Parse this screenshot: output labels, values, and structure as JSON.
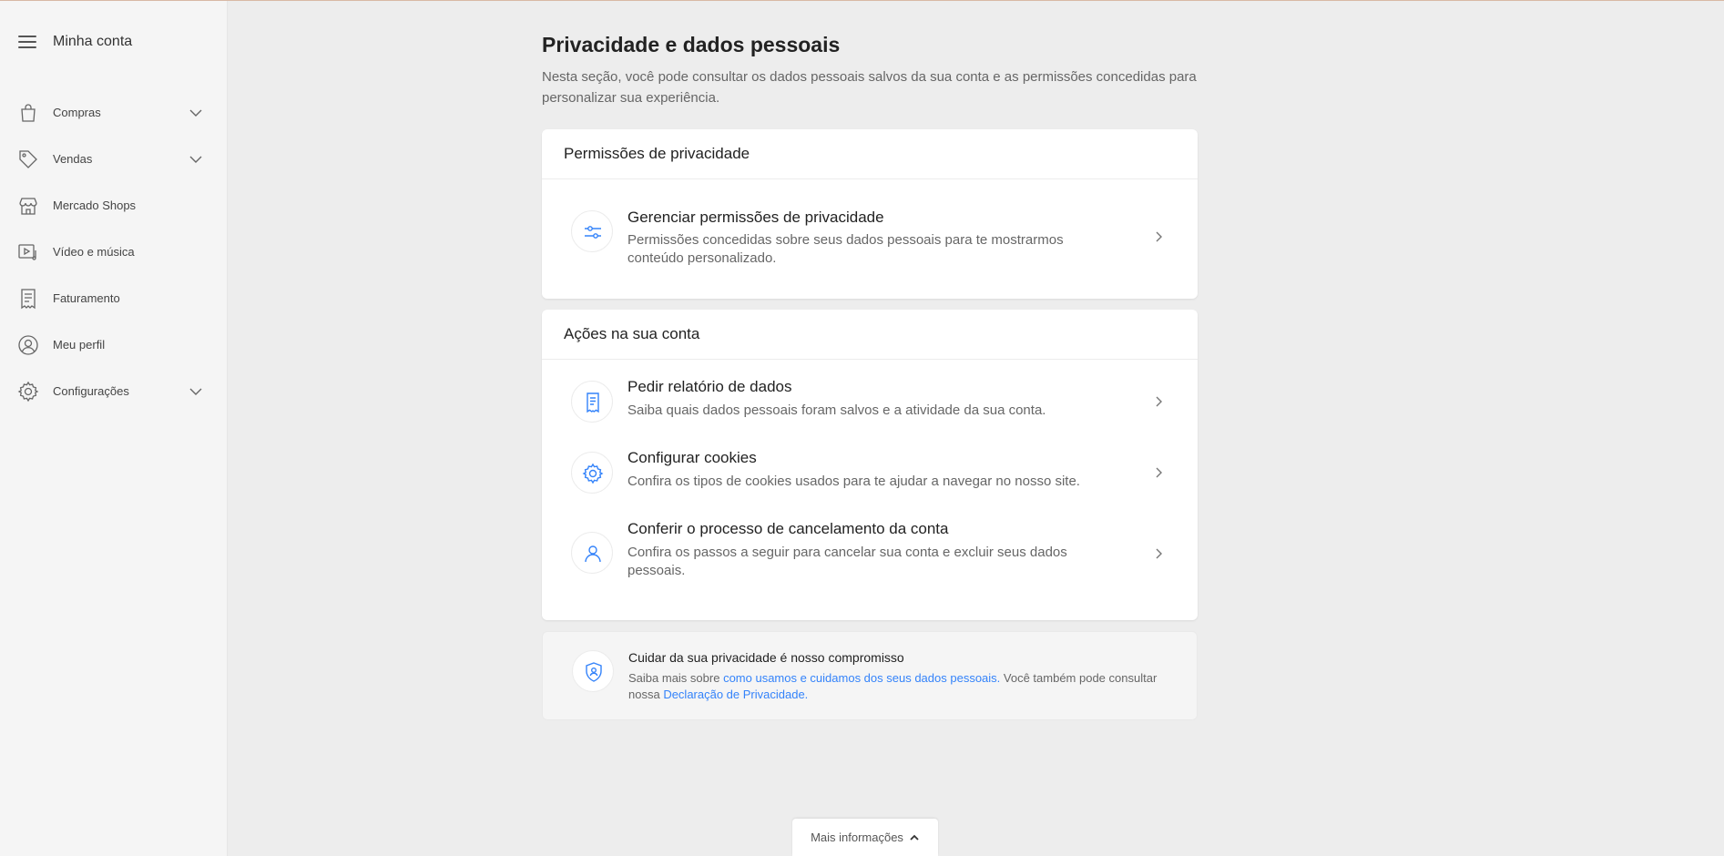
{
  "colors": {
    "accent": "#3483fa",
    "background": "#ededed",
    "sidebar": "#f5f5f5",
    "card": "#ffffff"
  },
  "sidebar": {
    "title": "Minha conta",
    "items": [
      {
        "label": "Compras",
        "icon": "bag-icon",
        "expandable": true
      },
      {
        "label": "Vendas",
        "icon": "tag-icon",
        "expandable": true
      },
      {
        "label": "Mercado Shops",
        "icon": "store-icon",
        "expandable": false
      },
      {
        "label": "Vídeo e música",
        "icon": "video-music-icon",
        "expandable": false
      },
      {
        "label": "Faturamento",
        "icon": "receipt-icon",
        "expandable": false
      },
      {
        "label": "Meu perfil",
        "icon": "profile-icon",
        "expandable": false
      },
      {
        "label": "Configurações",
        "icon": "gear-icon",
        "expandable": true
      }
    ]
  },
  "main": {
    "title": "Privacidade e dados pessoais",
    "description": "Nesta seção, você pode consultar os dados pessoais salvos da sua conta e as permissões concedidas para personalizar sua experiência.",
    "privacy_card": {
      "heading": "Permissões de privacidade",
      "rows": [
        {
          "title": "Gerenciar permissões de privacidade",
          "description": "Permissões concedidas sobre seus dados pessoais para te mostrarmos conteúdo personalizado.",
          "icon": "sliders-icon"
        }
      ]
    },
    "actions_card": {
      "heading": "Ações na sua conta",
      "rows": [
        {
          "title": "Pedir relatório de dados",
          "description": "Saiba quais dados pessoais foram salvos e a atividade da sua conta.",
          "icon": "report-icon"
        },
        {
          "title": "Configurar cookies",
          "description": "Confira os tipos de cookies usados para te ajudar a navegar no nosso site.",
          "icon": "gear-icon"
        },
        {
          "title": "Conferir o processo de cancelamento da conta",
          "description": "Confira os passos a seguir para cancelar sua conta e excluir seus dados pessoais.",
          "icon": "user-icon"
        }
      ]
    },
    "notice": {
      "title": "Cuidar da sua privacidade é nosso compromisso",
      "text_before": "Saiba mais sobre ",
      "link1": "como usamos e cuidamos dos seus dados pessoais.",
      "text_middle": " Você também pode consultar nossa ",
      "link2": "Declaração de Privacidade.",
      "icon": "shield-icon"
    }
  },
  "footer": {
    "more_label": "Mais informações"
  }
}
